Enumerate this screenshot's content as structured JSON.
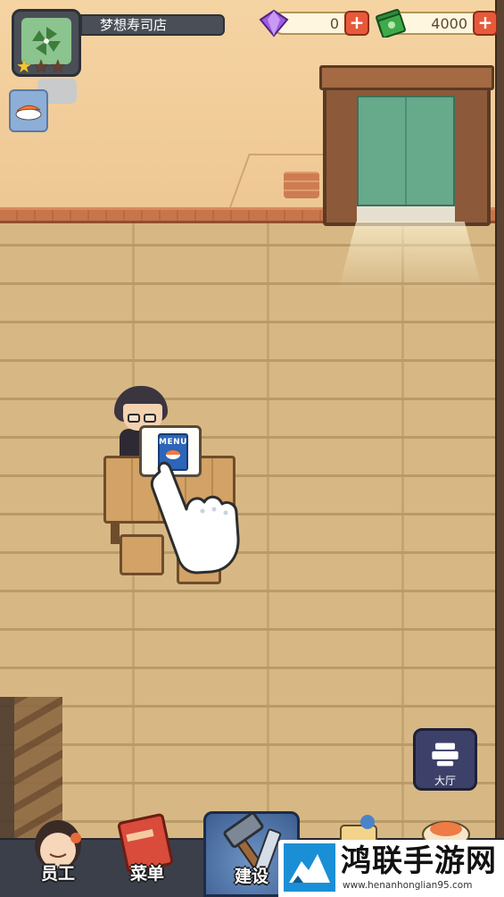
{
  "shop": {
    "name": "梦想寿司店",
    "stars_earned": 1,
    "stars_total": 3
  },
  "currencies": {
    "gems": "0",
    "cash": "4000",
    "plus_label": "+"
  },
  "scene": {
    "menu_card_label": "MENU"
  },
  "hall_button": {
    "label": "大厅"
  },
  "bottom_nav": {
    "staff": "员工",
    "menu": "菜单",
    "build": "建设"
  },
  "watermark": {
    "title": "鸿联手游网",
    "url": "www.henanhonglian95.com"
  },
  "colors": {
    "gem": "#a05ce0",
    "cash": "#3faa4a",
    "plus_button": "#e65a3b",
    "build_tab": "#4f74a8"
  }
}
